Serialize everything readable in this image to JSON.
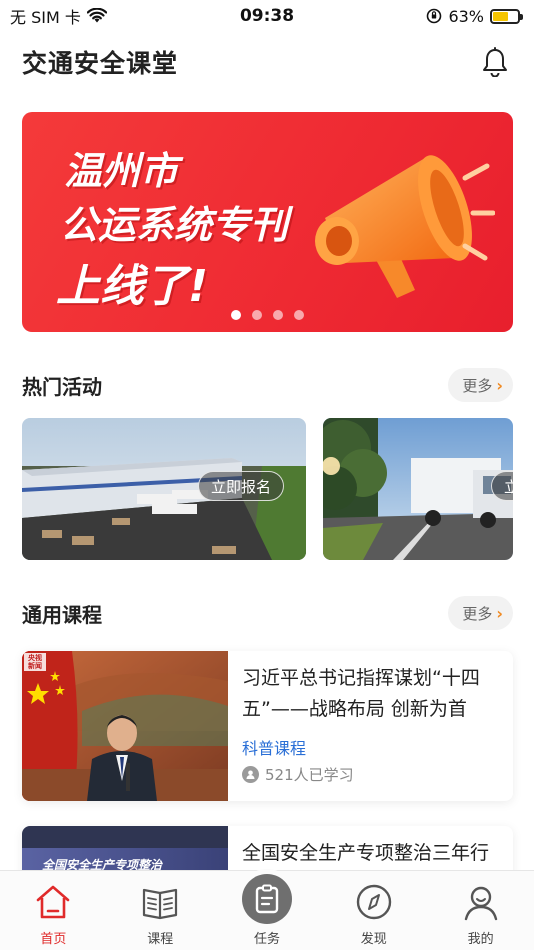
{
  "status_bar": {
    "carrier": "无 SIM 卡",
    "time": "09:38",
    "battery": "63%",
    "battery_level": 0.63
  },
  "header": {
    "title": "交通安全课堂",
    "bell_icon": "bell-icon"
  },
  "banner": {
    "line1": "温州市",
    "line2": "公运系统专刊",
    "line3": "上线了!",
    "slide_count": 4,
    "active_slide": 1,
    "colors": {
      "background": "#ef2b33",
      "accent": "#f5861f"
    }
  },
  "hot_activities": {
    "title": "热门活动",
    "more_label": "更多",
    "items": [
      {
        "button_label": "立即报名"
      },
      {
        "button_label": "立"
      }
    ]
  },
  "general_courses": {
    "title": "通用课程",
    "more_label": "更多",
    "items": [
      {
        "thumb_badge": "央视新闻",
        "title": "习近平总书记指挥谋划“十四五”——战略布局 创新为首",
        "tag": "科普课程",
        "learners": "521人已学习"
      },
      {
        "thumb_text": "全国安全生产专项整治",
        "title": "全国安全生产专项整治三年行"
      }
    ]
  },
  "tab_bar": {
    "tabs": [
      {
        "label": "首页",
        "icon": "home-icon",
        "active": true
      },
      {
        "label": "课程",
        "icon": "book-icon",
        "active": false
      },
      {
        "label": "任务",
        "icon": "task-icon",
        "active": false
      },
      {
        "label": "发现",
        "icon": "compass-icon",
        "active": false
      },
      {
        "label": "我的",
        "icon": "user-icon",
        "active": false
      }
    ],
    "active_color": "#e02a2a"
  }
}
